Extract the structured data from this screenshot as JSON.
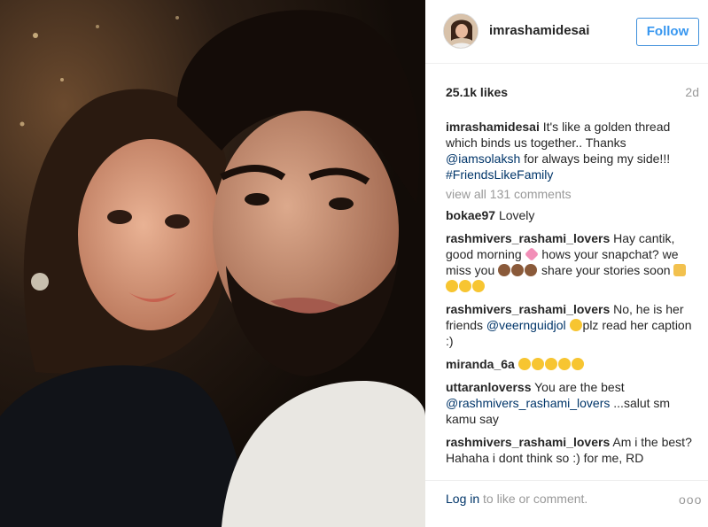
{
  "post": {
    "username": "imrashamidesai",
    "follow_label": "Follow",
    "likes": "25.1k likes",
    "age": "2d"
  },
  "caption": {
    "user": "imrashamidesai",
    "text1": "It's like a golden thread which binds us together.. Thanks",
    "mention": "@iamsolaksh",
    "text2": "for always being my side!!!",
    "hashtag": "#FriendsLikeFamily"
  },
  "view_all": "view all 131 comments",
  "comments": [
    {
      "user": "bokae97",
      "text": "Lovely"
    },
    {
      "user": "rashmivers_rashami_lovers",
      "text_a": "Hay cantik, good morning",
      "text_b": "hows your snapchat? we miss you",
      "text_c": "share your stories soon"
    },
    {
      "user": "rashmivers_rashami_lovers",
      "text_a": "No, he is her friends",
      "mention": "@veernguidjol",
      "text_b": "plz read her caption :)"
    },
    {
      "user": "miranda_6a",
      "text": ""
    },
    {
      "user": "uttaranloverss",
      "text_a": "You are the best",
      "mention": "@rashmivers_rashami_lovers",
      "text_b": "...salut sm kamu say"
    },
    {
      "user": "rashmivers_rashami_lovers",
      "text": "Am i the best? Hahaha i dont think so :) for me, RD"
    }
  ],
  "footer": {
    "login_link": "Log in",
    "login_text": "to like or comment.",
    "more": "ooo"
  },
  "icons": {
    "heart_emoji": "two-hearts-icon",
    "monkey_emoji": "see-no-evil-monkey-icon",
    "pray_emoji": "folded-hands-icon",
    "kiss_emoji": "face-blowing-kiss-icon",
    "grin_emoji": "grinning-face-icon",
    "wink_emoji": "winking-face-icon"
  },
  "colors": {
    "follow_blue": "#3897f0",
    "link_navy": "#003569",
    "muted_gray": "#999999",
    "text_dark": "#262626"
  }
}
